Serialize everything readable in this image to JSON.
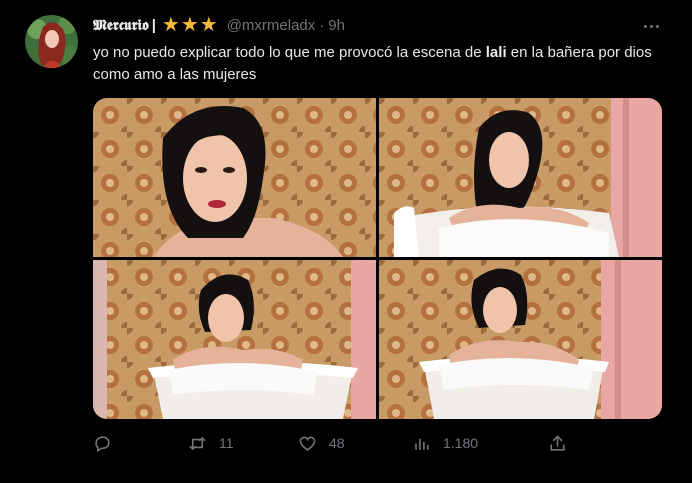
{
  "tweet": {
    "display_name": "𝕸𝖊𝖗𝖈𝖚𝖗𝖎𝖔",
    "separator": "|",
    "stars": "★★★",
    "handle": "@mxrmeladx",
    "dot": "·",
    "time": "9h",
    "text_part1": "yo no puedo explicar todo lo que me provocó la escena de ",
    "text_bold": "lali",
    "text_part2": " en la bañera por dios como amo a las mujeres",
    "icons": {
      "more": "more-icon",
      "reply": "reply-icon",
      "retweet": "retweet-icon",
      "like": "like-icon",
      "views": "views-icon",
      "share": "share-icon"
    },
    "colors": {
      "background": "#000000",
      "text": "#e7e9ea",
      "muted": "#71767b",
      "stars": "#f6b93b"
    }
  },
  "actions": {
    "replies": "",
    "retweets": "11",
    "likes": "48",
    "views": "1.180"
  }
}
